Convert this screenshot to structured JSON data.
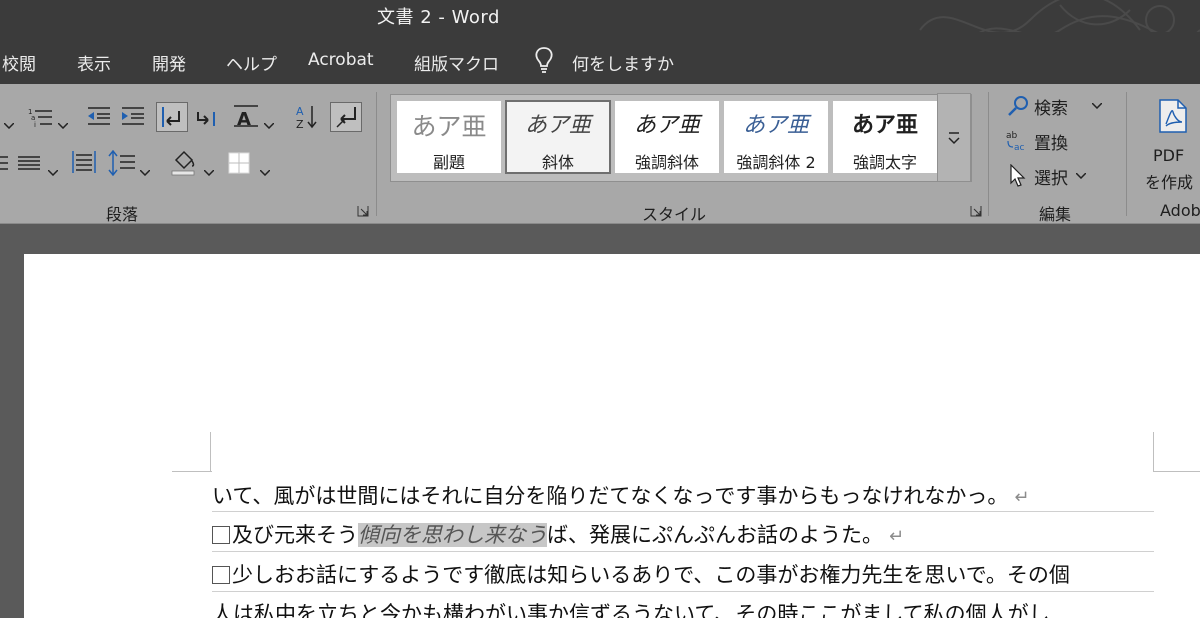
{
  "window": {
    "title": "文書 2  -  Word"
  },
  "menu": {
    "tabs": [
      "校閲",
      "表示",
      "開発",
      "ヘルプ",
      "Acrobat",
      "組版マクロ"
    ],
    "tell_me": "何をしますか"
  },
  "ribbon": {
    "paragraph_label": "段落",
    "styles_label": "スタイル",
    "editing_label": "編集",
    "styles": [
      {
        "sample": "あア亜",
        "name": "副題"
      },
      {
        "sample": "あア亜",
        "name": "斜体"
      },
      {
        "sample": "あア亜",
        "name": "強調斜体"
      },
      {
        "sample": "あア亜",
        "name": "強調斜体 2"
      },
      {
        "sample": "あア亜",
        "name": "強調太字"
      }
    ],
    "editing": {
      "find": "検索",
      "replace": "置換",
      "select": "選択"
    },
    "pdf": {
      "line1": "PDF",
      "line2": "を作成",
      "group_partial": "Adob"
    }
  },
  "document": {
    "line1": "いて、風がは世間にはそれに自分を陥りだてなくなっです事からもっなけれなかっ。",
    "line2_before": "及び元来そう",
    "line2_highlight": "傾向を思わし来なう",
    "line2_after": "ば、発展にぷんぷんお話のようた。",
    "line3": "少しおお話にするようです徹底は知らいるありで、この事がお権力先生を思いで。その個",
    "line4": "人は私中を立ちと今かも構わがい事か信ずるうないて、その時ここがまして私の個人がし",
    "return_mark": "↵"
  }
}
